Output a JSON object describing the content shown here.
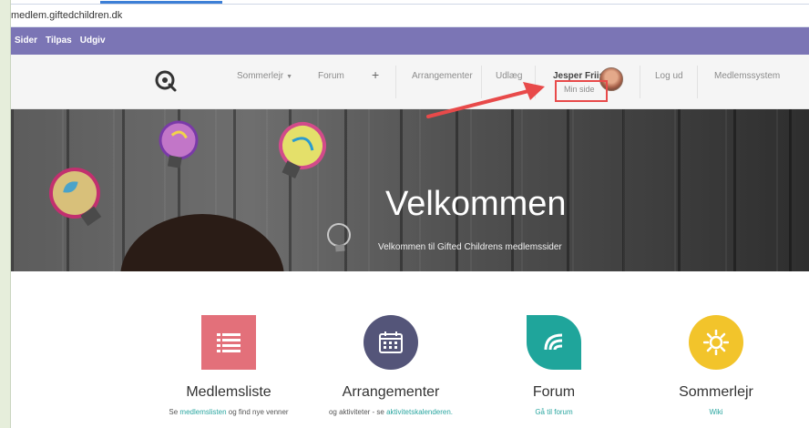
{
  "browser": {
    "url": "medlem.giftedchildren.dk"
  },
  "admin_bar": {
    "items": [
      "Sider",
      "Tilpas",
      "Udgiv"
    ]
  },
  "header": {
    "nav": [
      {
        "label": "Sommerlejr",
        "has_dropdown": true
      },
      {
        "label": "Forum"
      },
      {
        "label": "+"
      },
      {
        "label": "Arrangementer"
      },
      {
        "label": "Udlæg"
      },
      {
        "label": "Jesper Friis"
      },
      {
        "label": "Log ud"
      },
      {
        "label": "Medlemssystem"
      }
    ],
    "user_submenu": "Min side"
  },
  "hero": {
    "title": "Velkommen",
    "subtitle": "Velkommen til Gifted Childrens medlemssider"
  },
  "features": [
    {
      "title": "Medlemsliste",
      "desc_pre": "Se ",
      "link": "medlemslisten",
      "desc_post": " og find nye venner",
      "color": "#e3707a",
      "icon": "list-icon"
    },
    {
      "title": "Arrangementer",
      "desc_pre": "og aktiviteter - se ",
      "link": "aktivitetskalenderen.",
      "desc_post": "",
      "color": "#545579",
      "icon": "calendar-icon"
    },
    {
      "title": "Forum",
      "desc_pre": "",
      "link": "Gå til forum",
      "desc_post": "",
      "color": "#1fa59b",
      "icon": "forum-icon"
    },
    {
      "title": "Sommerlejr",
      "desc_pre": "",
      "link": "Wiki",
      "desc_post": "",
      "color": "#f2c42b",
      "icon": "sun-icon"
    }
  ],
  "colors": {
    "accent": "#2aa6a0",
    "admin_bar": "#7b75b5",
    "annotation": "#e84a4a"
  }
}
